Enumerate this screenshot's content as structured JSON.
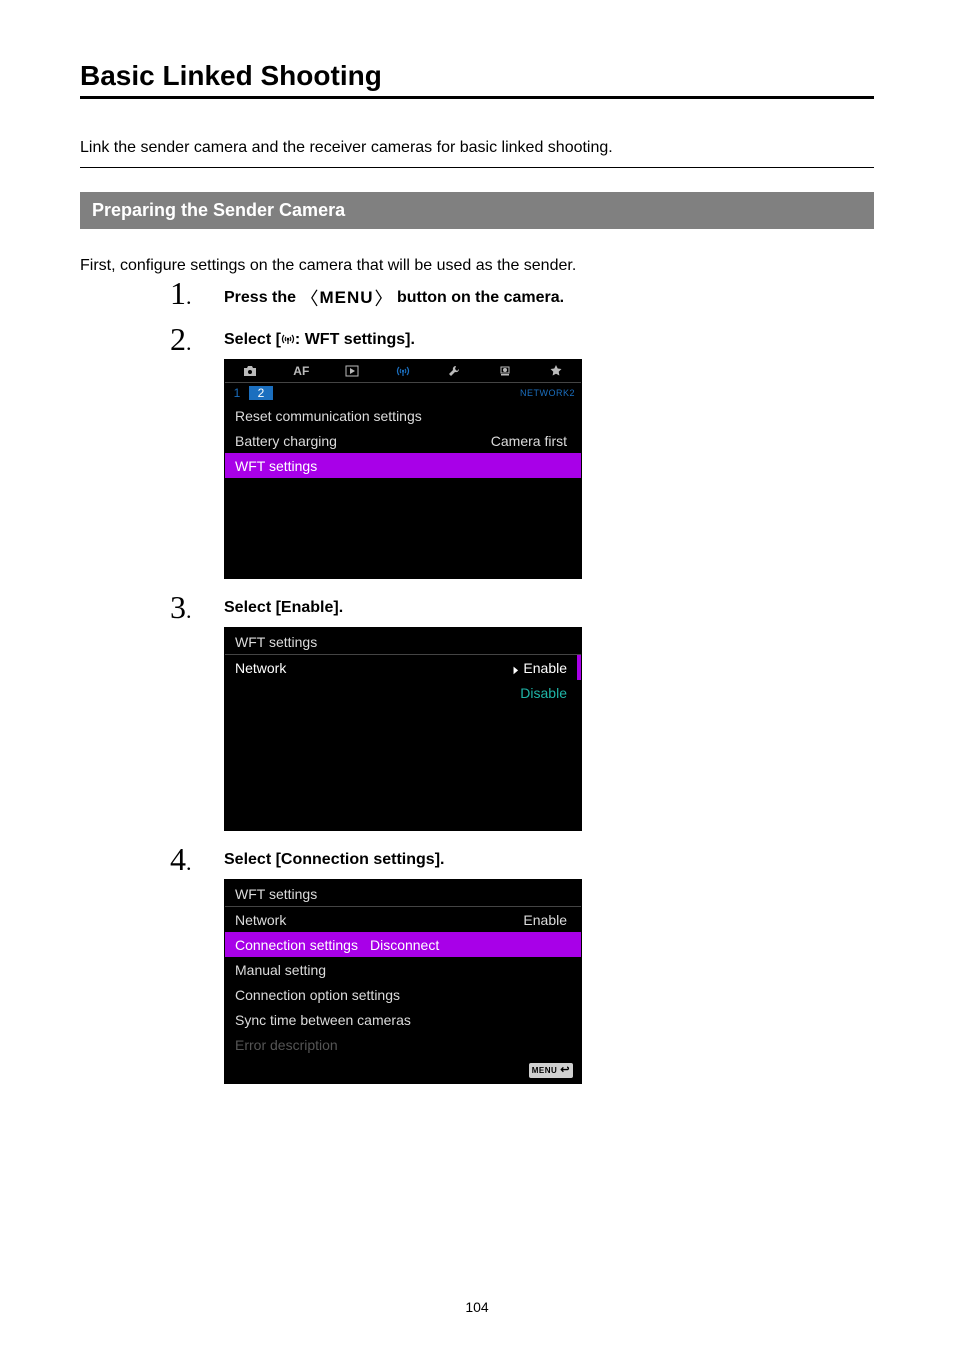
{
  "page_number": "104",
  "heading": "Basic Linked Shooting",
  "intro": "Link the sender camera and the receiver cameras for basic linked shooting.",
  "section_title": "Preparing the Sender Camera",
  "section_intro": "First, configure settings on the camera that will be used as the sender.",
  "steps": [
    {
      "num": "1",
      "title_pre": "Press the ",
      "title_icon": "MENU",
      "title_post": " button on the camera."
    },
    {
      "num": "2",
      "title_pre": "Select [",
      "title_icon": "((antenna))",
      "title_post": ": WFT settings]."
    },
    {
      "num": "3",
      "title_full": "Select [Enable]."
    },
    {
      "num": "4",
      "title_full": "Select [Connection settings]."
    }
  ],
  "lcd1": {
    "tabs_text": {
      "af": "AF"
    },
    "sub1": "1",
    "sub2": "2",
    "net": "NETWORK2",
    "row1": "Reset communication settings",
    "row2_l": "Battery charging",
    "row2_r": "Camera first",
    "row3": "WFT settings"
  },
  "lcd2": {
    "title": "WFT settings",
    "row1_l": "Network",
    "opt1": "Enable",
    "opt2": "Disable"
  },
  "lcd3": {
    "title": "WFT settings",
    "r1_l": "Network",
    "r1_r": "Enable",
    "r2_l": "Connection settings",
    "r2_r": "Disconnect",
    "r3": "Manual setting",
    "r4": "Connection option settings",
    "r5": "Sync time between cameras",
    "r6": "Error description",
    "menu_btn": "MENU"
  }
}
